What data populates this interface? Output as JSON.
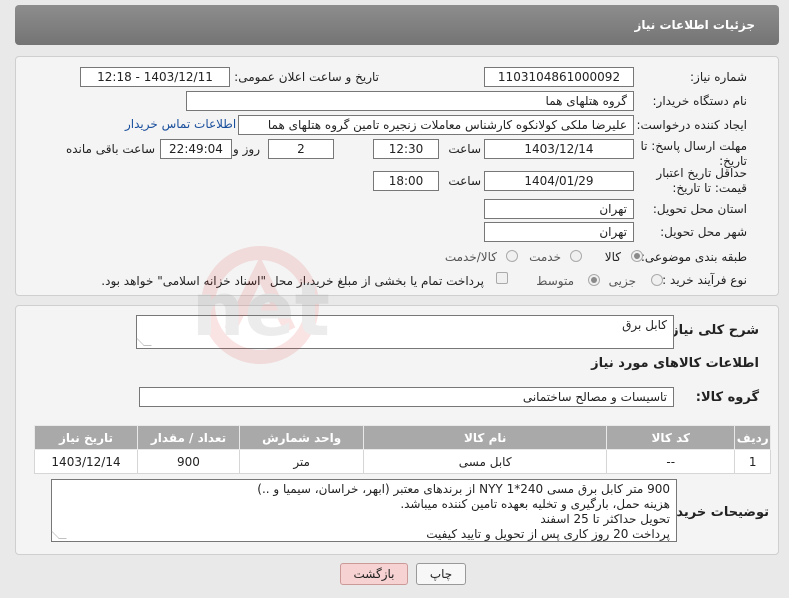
{
  "header": {
    "title": "جزئیات اطلاعات نیاز"
  },
  "form": {
    "need_number_label": "شماره نیاز:",
    "need_number": "1103104861000092",
    "announce_label": "تاریخ و ساعت اعلان عمومی:",
    "announce_value": "1403/12/11 - 12:18",
    "buyer_org_label": "نام دستگاه خریدار:",
    "buyer_org": "گروه هتلهای هما",
    "creator_label": "ایجاد کننده درخواست:",
    "creator": "علیرضا ملکی کولانکوه کارشناس معاملات زنجیره تامین گروه هتلهای هما",
    "contact_link": "اطلاعات تماس خریدار",
    "deadline_label": "مهلت ارسال پاسخ: تا تاریخ:",
    "deadline_date": "1403/12/14",
    "time_label": "ساعت",
    "deadline_time": "12:30",
    "days_value": "2",
    "days_label": "روز و",
    "remaining_time": "22:49:04",
    "remaining_label": "ساعت باقی مانده",
    "validity_label": "حداقل تاریخ اعتبار قیمت: تا تاریخ:",
    "validity_date": "1404/01/29",
    "validity_time": "18:00",
    "province_label": "استان محل تحویل:",
    "province": "تهران",
    "city_label": "شهر محل تحویل:",
    "city": "تهران",
    "category_label": "طبقه بندی موضوعی:",
    "category_options": [
      "کالا",
      "خدمت",
      "کالا/خدمت"
    ],
    "process_label": "نوع فرآیند خرید :",
    "process_options": [
      "جزیی",
      "متوسط"
    ],
    "payment_note": "پرداخت تمام یا بخشی از مبلغ خرید،از محل \"اسناد خزانه اسلامی\" خواهد بود."
  },
  "details": {
    "summary_label": "شرح کلی نیاز:",
    "summary": "کابل برق",
    "goods_info_title": "اطلاعات کالاهای مورد نیاز",
    "goods_group_label": "گروه کالا:",
    "goods_group": "تاسیسات و مصالح ساختمانی"
  },
  "table": {
    "headers": [
      "ردیف",
      "کد کالا",
      "نام کالا",
      "واحد شمارش",
      "تعداد / مقدار",
      "تاریخ نیاز"
    ],
    "rows": [
      [
        "1",
        "--",
        "کابل مسی",
        "متر",
        "900",
        "1403/12/14"
      ]
    ]
  },
  "buyer_notes": {
    "label": "توضیحات خریدار:",
    "lines": [
      "900 متر کابل برق مسی 240*1 NYY از برندهای معتبر (ابهر، خراسان، سیمیا و ..)",
      "هزینه حمل، بارگیری و تخلیه بعهده تامین کننده میباشد.",
      "تحویل حداکثر تا 25 اسفند",
      "پرداخت 20 روز کاری پس از تحویل و تایید کیفیت"
    ]
  },
  "buttons": {
    "print": "چاپ",
    "back": "بازگشت"
  },
  "colors": {
    "header_bg": "#7f7f7f",
    "link": "#1a4f9c",
    "table_header": "#a9a9a9",
    "back_button": "#f7d2d2"
  }
}
